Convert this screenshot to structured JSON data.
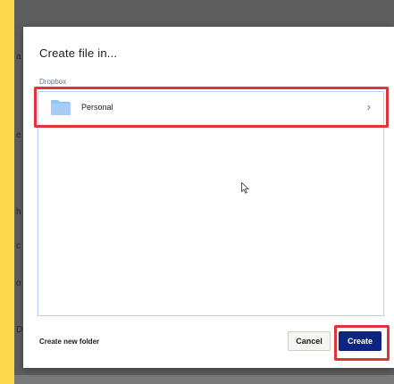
{
  "dialog": {
    "title": "Create file in...",
    "breadcrumb": "Dropbox",
    "folders": [
      {
        "name": "Personal",
        "icon": "folder-icon",
        "chevron": "›"
      }
    ],
    "new_folder_label": "Create new folder",
    "cancel_label": "Cancel",
    "create_label": "Create"
  },
  "colors": {
    "accent_yellow": "#fbd74c",
    "create_button": "#0d2481",
    "highlight_red": "#e0343c",
    "folder_blue": "#92c3f5",
    "list_border": "#b8cff0"
  }
}
